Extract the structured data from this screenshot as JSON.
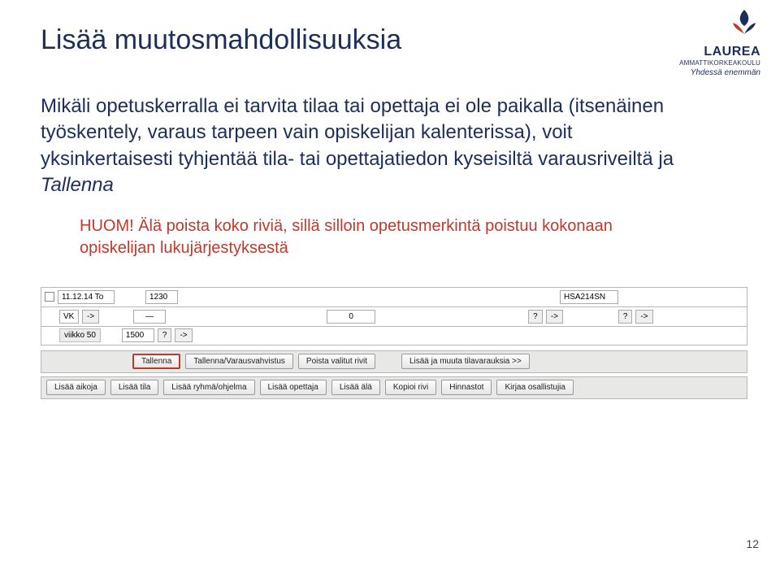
{
  "logo": {
    "name": "LAUREA",
    "sub": "AMMATTIKORKEAKOULU",
    "tagline": "Yhdessä enemmän"
  },
  "title": "Lisää muutosmahdollisuuksia",
  "body": {
    "line1": "Mikäli opetuskerralla ei tarvita tilaa tai opettaja ei ole paikalla (itsenäinen työskentely, varaus tarpeen vain opiskelijan kalenterissa), voit yksinkertaisesti tyhjentää tila- tai opettajatiedon kyseisiltä varausriveiltä ja ",
    "save": "Tallenna"
  },
  "note": "HUOM! Älä poista koko riviä, sillä silloin opetusmerkintä poistuu kokonaan opiskelijan lukujärjestyksestä",
  "row1": {
    "date": "11.12.14 To",
    "time_start": "1230",
    "arrow": "->",
    "course": "HSA214SN"
  },
  "row2": {
    "vk": "VK",
    "arrow": "->",
    "dash": "—",
    "zero": "0",
    "q": "?"
  },
  "row3": {
    "week": "viikko 50",
    "time_end": "1500",
    "q": "?",
    "arrow": "->"
  },
  "btns1": {
    "tallenna": "Tallenna",
    "varaus": "Tallenna/Varausvahvistus",
    "poista": "Poista valitut rivit",
    "lisaa_tila": "Lisää ja muuta tilavarauksia >>"
  },
  "btns2": {
    "lisaa_aikoja": "Lisää aikoja",
    "lisaa_tila2": "Lisää tila",
    "lisaa_ryhma": "Lisää ryhmä/ohjelma",
    "lisaa_opettaja": "Lisää opettaja",
    "lisaa_ala": "Lisää älä",
    "kopioi": "Kopioi rivi",
    "hinnastot": "Hinnastot",
    "kirjaa": "Kirjaa osallistujia"
  },
  "page": "12"
}
